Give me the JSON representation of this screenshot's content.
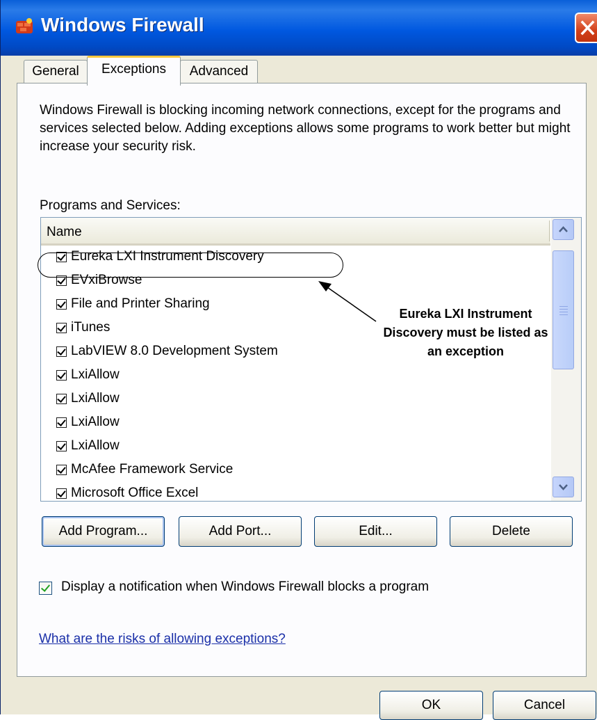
{
  "window": {
    "title": "Windows Firewall",
    "icon": "firewall-brick-icon",
    "close_icon": "close-icon"
  },
  "tabs": [
    {
      "label": "General",
      "active": false
    },
    {
      "label": "Exceptions",
      "active": true
    },
    {
      "label": "Advanced",
      "active": false
    }
  ],
  "exceptions": {
    "description": "Windows Firewall is blocking incoming network connections, except for the programs and services selected below. Adding exceptions allows some programs to work better but might increase your security risk.",
    "programs_label": "Programs and Services:",
    "column_name": "Name",
    "items": [
      {
        "label": "Eureka LXI Instrument Discovery",
        "checked": true
      },
      {
        "label": "EVxiBrowse",
        "checked": true
      },
      {
        "label": "File and Printer Sharing",
        "checked": true
      },
      {
        "label": "iTunes",
        "checked": true
      },
      {
        "label": "LabVIEW 8.0 Development System",
        "checked": true
      },
      {
        "label": "LxiAllow",
        "checked": true
      },
      {
        "label": "LxiAllow",
        "checked": true
      },
      {
        "label": "LxiAllow",
        "checked": true
      },
      {
        "label": "LxiAllow",
        "checked": true
      },
      {
        "label": "McAfee Framework Service",
        "checked": true
      },
      {
        "label": "Microsoft Office Excel",
        "checked": true
      }
    ],
    "buttons": {
      "add_program": "Add Program...",
      "add_port": "Add Port...",
      "edit": "Edit...",
      "delete": "Delete"
    },
    "notify_label": "Display a notification when Windows Firewall blocks a program",
    "notify_checked": true,
    "risk_link": "What are the risks of allowing exceptions?"
  },
  "annotation": {
    "text": "Eureka LXI Instrument Discovery must be listed as an exception"
  },
  "footer": {
    "ok": "OK",
    "cancel": "Cancel"
  },
  "colors": {
    "titlebar": "#0058e0",
    "dialog_bg": "#ece9d8",
    "active_tab_accent": "#ffc83c",
    "link": "#1a2fa8",
    "check_green": "#21a121"
  }
}
